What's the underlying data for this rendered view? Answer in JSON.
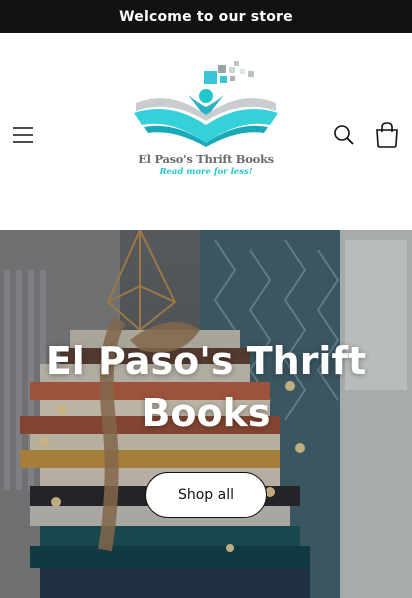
{
  "announcement": {
    "text": "Welcome to our store"
  },
  "header": {
    "logo_name": "El Paso's Thrift Books",
    "logo_tagline": "Read more for less!",
    "icons": [
      "hamburger-menu-icon",
      "search-icon",
      "shopping-bag-icon"
    ]
  },
  "hero": {
    "title": "El Paso's Thrift Books",
    "button_label": "Shop all"
  },
  "colors": {
    "announcement_bg": "#121212",
    "brand_teal": "#1ec7c9",
    "text_dark": "#121212"
  }
}
